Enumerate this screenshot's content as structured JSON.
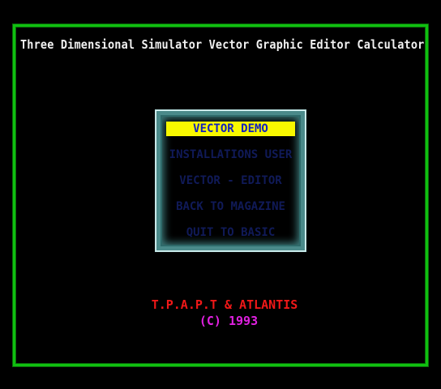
{
  "header": {
    "title": "Three Dimensional Simulator Vector Graphic Editor Calculator"
  },
  "menu": {
    "selected_index": 0,
    "items": [
      {
        "label": "VECTOR DEMO"
      },
      {
        "label": "INSTALLATIONS USER"
      },
      {
        "label": "VECTOR - EDITOR"
      },
      {
        "label": "BACK TO MAGAZINE"
      },
      {
        "label": "QUIT TO BASIC"
      }
    ]
  },
  "footer": {
    "authors": "T.P.A.P.T & ATLANTIS",
    "copyright": "(C) 1993"
  },
  "colors": {
    "background": "#000000",
    "frame": "#10c010",
    "title_text": "#f2f2f2",
    "menu_border": "#4a8a8a",
    "selected_bar": "#f8f800",
    "selected_text": "#1020c0",
    "unselected_text": "#101a58",
    "authors_text": "#f01818",
    "copyright_text": "#e020e0"
  }
}
